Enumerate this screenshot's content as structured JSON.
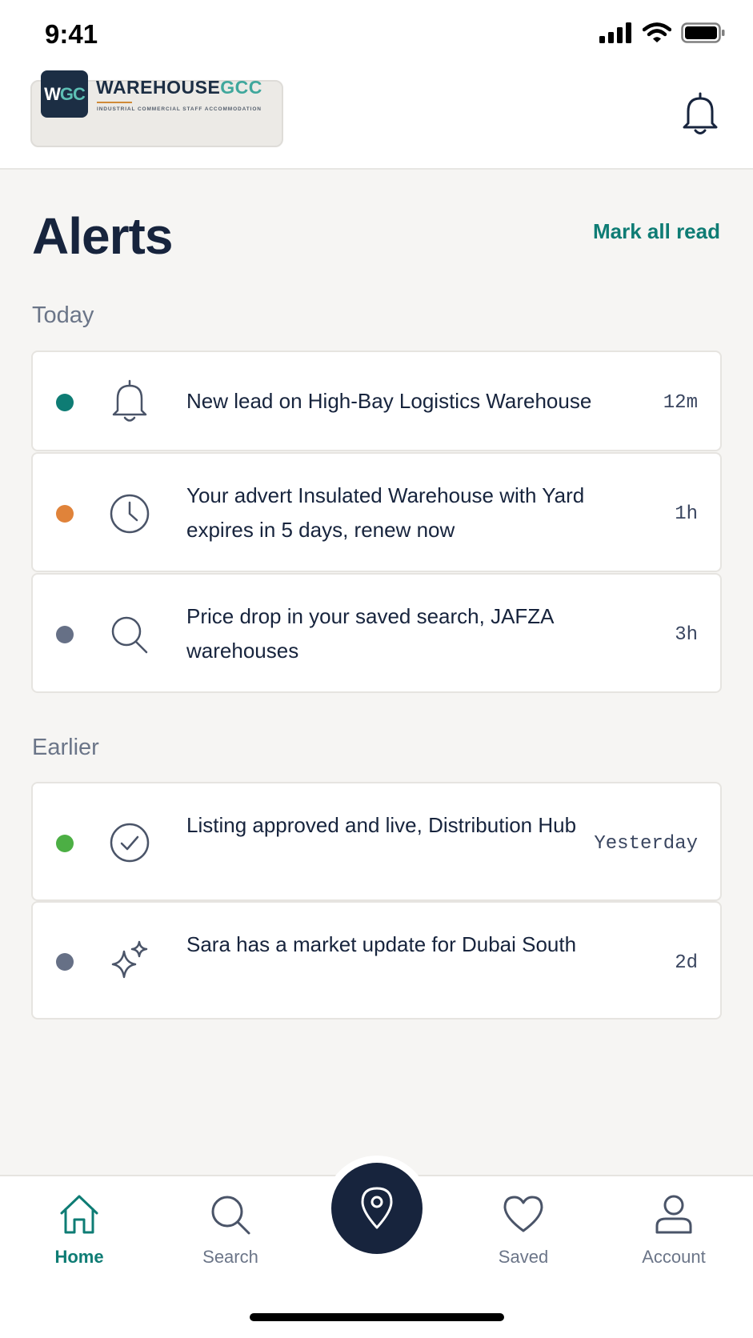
{
  "status_bar": {
    "time": "9:41"
  },
  "brand": {
    "badge_w": "W",
    "badge_gc": "GC",
    "name_main": "WAREHOUSE",
    "name_accent": "GCC",
    "tagline": "INDUSTRIAL COMMERCIAL STAFF ACCOMMODATION"
  },
  "header": {
    "title": "Alerts",
    "mark_all_label": "Mark all read"
  },
  "sections": {
    "today_label": "Today",
    "earlier_label": "Earlier"
  },
  "alerts": [
    {
      "text": "New lead on High-Bay Logistics Warehouse",
      "time": "12m",
      "icon": "bell-icon",
      "dot_color": "#0e7c74"
    },
    {
      "text": "Your advert Insulated Warehouse with Yard expires in 5 days, renew now",
      "time": "1h",
      "icon": "clock-icon",
      "dot_color": "#e0833a"
    },
    {
      "text": "Price drop in your saved search, JAFZA warehouses",
      "time": "3h",
      "icon": "search-icon",
      "dot_color": "#667086"
    },
    {
      "text": "Listing approved and live, Distribution Hub",
      "time": "Yesterday",
      "icon": "check-circle-icon",
      "dot_color": "#4caf44"
    },
    {
      "text": "Sara has a market update for Dubai South",
      "time": "2d",
      "icon": "sparkle-icon",
      "dot_color": "#667086"
    }
  ],
  "tabs": [
    {
      "label": "Home",
      "icon": "home-icon",
      "active": true
    },
    {
      "label": "Search",
      "icon": "search-icon"
    },
    {
      "label": "Saved",
      "icon": "heart-icon"
    },
    {
      "label": "Account",
      "icon": "user-icon"
    }
  ],
  "fab_icon": "map-pin-icon",
  "colors": {
    "navy": "#17243d",
    "teal": "#0e7c74",
    "background": "#f6f5f3"
  }
}
